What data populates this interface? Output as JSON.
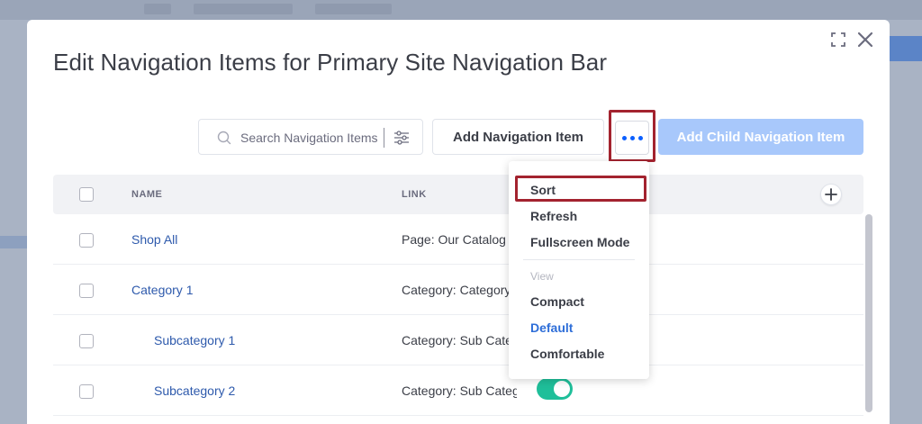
{
  "modal": {
    "title": "Edit Navigation Items for Primary Site Navigation Bar"
  },
  "toolbar": {
    "search_placeholder": "Search Navigation Items",
    "add_label": "Add Navigation Item",
    "add_child_label": "Add Child Navigation Item"
  },
  "table": {
    "columns": [
      "NAME",
      "LINK"
    ],
    "rows": [
      {
        "name": "Shop All",
        "link": "Page: Our Catalog"
      },
      {
        "name": "Category 1",
        "link": "Category: Category 1"
      },
      {
        "name": "Subcategory 1",
        "link": "Category: Sub Category 1"
      },
      {
        "name": "Subcategory 2",
        "link": "Category: Sub Category 2"
      }
    ]
  },
  "menu": {
    "items": [
      "Sort",
      "Refresh",
      "Fullscreen Mode"
    ],
    "view_section": "View",
    "view_options": [
      "Compact",
      "Default",
      "Comfortable"
    ],
    "selected_view": "Default"
  },
  "colors": {
    "primary": "#0b5fff",
    "highlight": "#a3232f",
    "toggle_on": "#1fbf9a",
    "link": "#2e5aac"
  },
  "icons": {
    "expand": "expand-icon",
    "close": "close-icon",
    "search": "search-icon",
    "filter": "filter-icon",
    "more": "ellipsis-icon",
    "add_column": "plus-icon"
  }
}
